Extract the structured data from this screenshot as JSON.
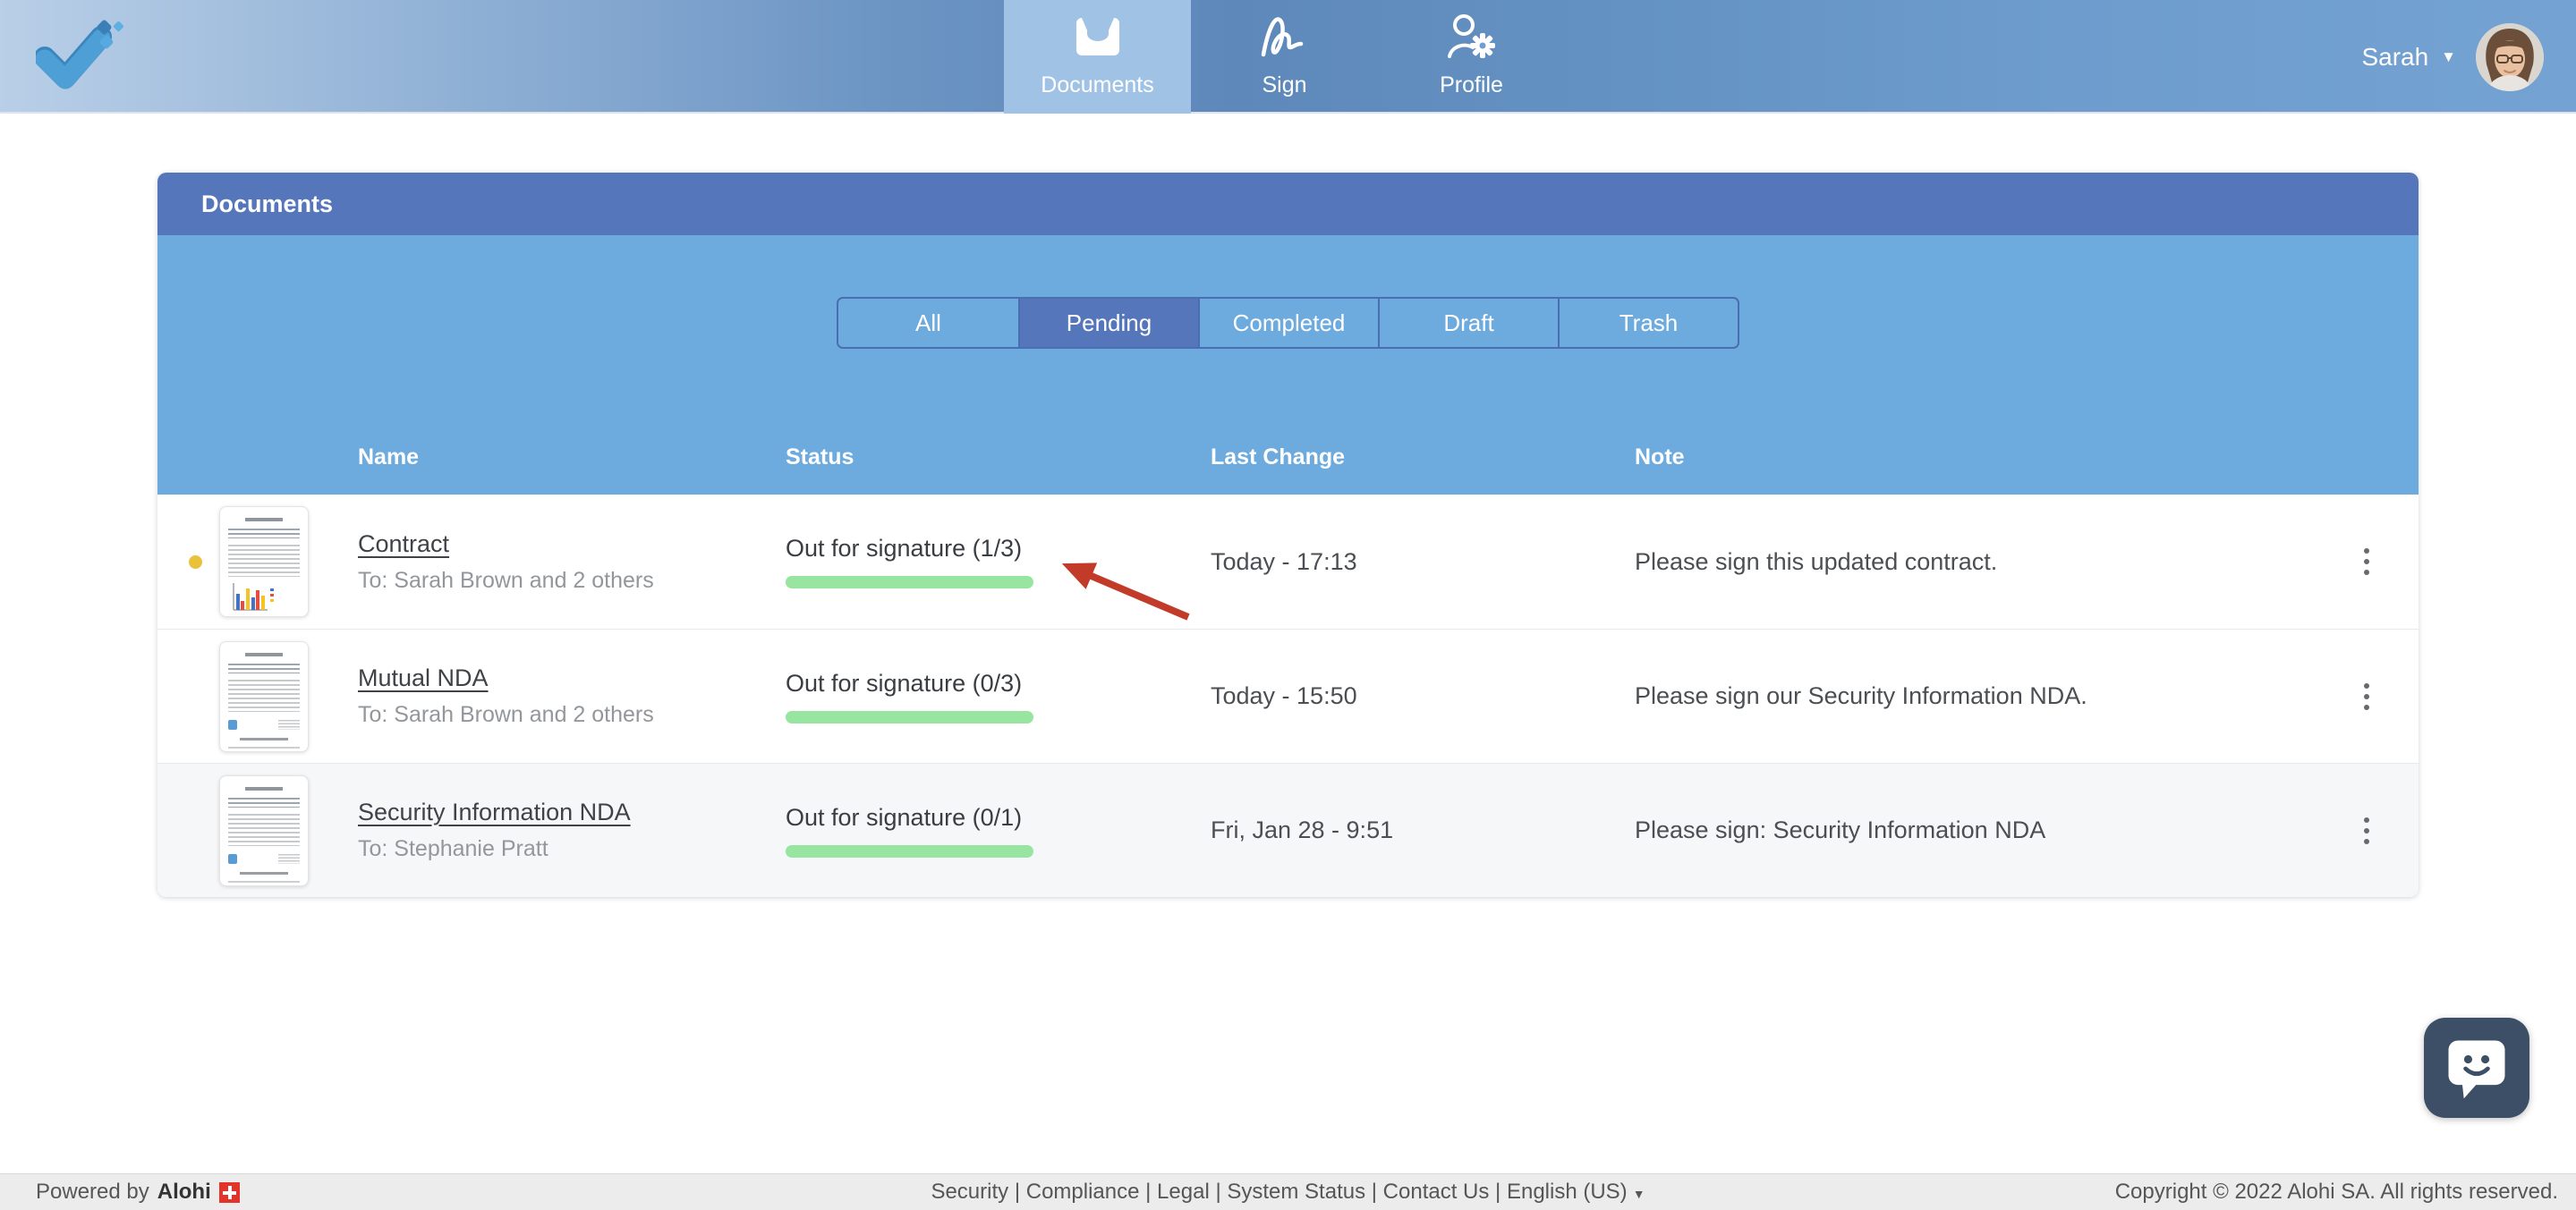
{
  "nav": {
    "tabs": [
      {
        "label": "Documents",
        "icon": "inbox-icon"
      },
      {
        "label": "Sign",
        "icon": "signature-icon"
      },
      {
        "label": "Profile",
        "icon": "profile-gear-icon"
      }
    ],
    "active_tab": 0,
    "user": {
      "name": "Sarah"
    }
  },
  "panel": {
    "title": "Documents",
    "filters": {
      "items": [
        "All",
        "Pending",
        "Completed",
        "Draft",
        "Trash"
      ],
      "active_index": 1
    },
    "table": {
      "headers": [
        "Name",
        "Status",
        "Last Change",
        "Note"
      ],
      "rows": [
        {
          "name": "Contract",
          "to": "To: Sarah Brown and 2 others",
          "status": "Out for signature (1/3)",
          "progress_pct": 33,
          "last_change": "Today - 17:13",
          "note": "Please sign this updated contract.",
          "unread": true,
          "thumb": "chart",
          "shaded": false
        },
        {
          "name": "Mutual NDA",
          "to": "To: Sarah Brown and 2 others",
          "status": "Out for signature (0/3)",
          "progress_pct": 0,
          "last_change": "Today - 15:50",
          "note": "Please sign our Security Information NDA.",
          "unread": false,
          "thumb": "text",
          "shaded": false
        },
        {
          "name": "Security Information NDA",
          "to": "To: Stephanie Pratt",
          "status": "Out for signature (0/1)",
          "progress_pct": 0,
          "last_change": "Fri, Jan 28 - 9:51",
          "note": "Please sign: Security Information NDA",
          "unread": false,
          "thumb": "text",
          "shaded": true
        }
      ]
    }
  },
  "footer": {
    "powered_by": "Powered by",
    "brand": "Alohi",
    "links": [
      "Security",
      "Compliance",
      "Legal",
      "System Status",
      "Contact Us"
    ],
    "language": "English (US)",
    "copyright": "Copyright © 2022 Alohi SA. All rights reserved."
  },
  "colors": {
    "header_blue": "#5576ba",
    "panel_blue": "#6daade",
    "active_tab_blue": "#a0c3e5",
    "progress_green": "#3f9c3c",
    "progress_light_green": "#98e5a1",
    "unread_yellow": "#e9c23a",
    "arrow_red": "#c23b28",
    "chat_navy": "#3d4f66",
    "flag_red": "#e2342b"
  }
}
